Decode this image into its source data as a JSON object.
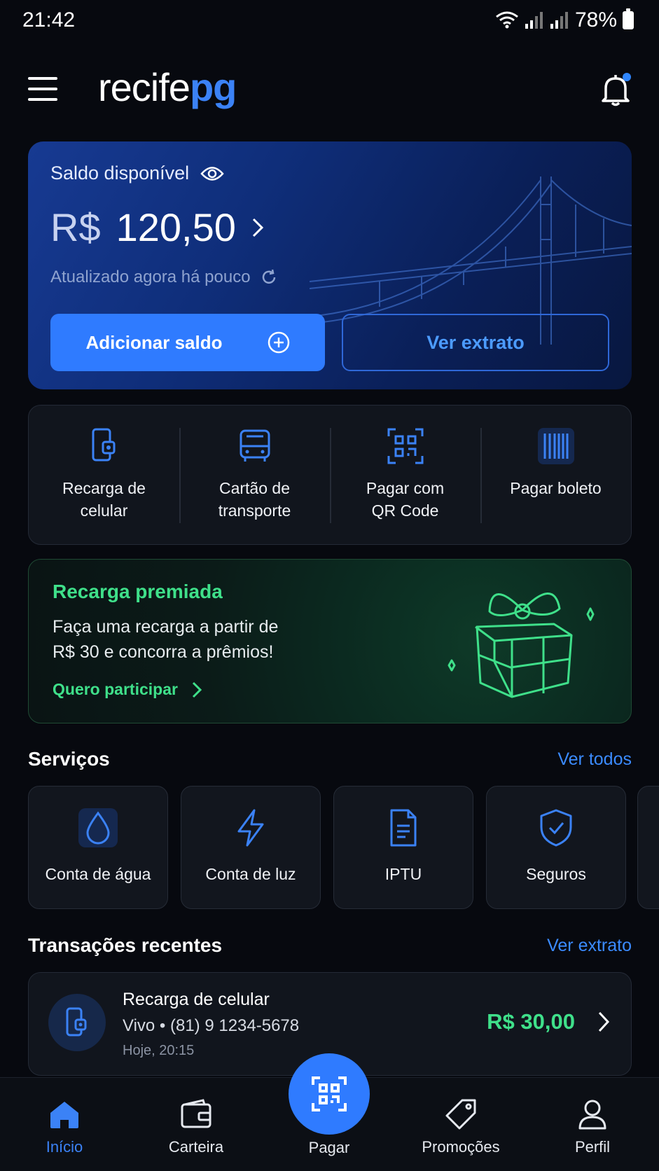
{
  "status_bar": {
    "time": "21:42",
    "battery": "78%"
  },
  "header": {
    "logo_part1": "recife",
    "logo_part2": "pg"
  },
  "balance": {
    "label": "Saldo disponível",
    "currency": "R$",
    "amount": "120,50",
    "updated": "Atualizado agora há pouco",
    "add_button": "Adicionar saldo",
    "extract_button": "Ver extrato"
  },
  "quick_actions": [
    {
      "label": "Recarga de\ncelular",
      "icon": "phone-recharge-icon"
    },
    {
      "label": "Cartão de\ntransporte",
      "icon": "bus-icon"
    },
    {
      "label": "Pagar com\nQR Code",
      "icon": "qr-code-icon"
    },
    {
      "label": "Pagar boleto",
      "icon": "barcode-icon"
    }
  ],
  "promo": {
    "title": "Recarga premiada",
    "text": "Faça uma recarga a partir de\nR$ 30 e concorra a prêmios!",
    "link": "Quero participar"
  },
  "services": {
    "title": "Serviços",
    "link": "Ver todos",
    "items": [
      {
        "label": "Conta de água",
        "icon": "water-drop-icon"
      },
      {
        "label": "Conta de luz",
        "icon": "lightning-icon"
      },
      {
        "label": "IPTU",
        "icon": "document-icon"
      },
      {
        "label": "Seguros",
        "icon": "shield-icon"
      }
    ]
  },
  "transactions": {
    "title": "Transações recentes",
    "link": "Ver extrato",
    "items": [
      {
        "title": "Recarga de celular",
        "subtitle": "Vivo • (81) 9 1234-5678",
        "time": "Hoje, 20:15",
        "amount": "R$ 30,00"
      }
    ]
  },
  "bottom_nav": {
    "items": [
      "Início",
      "Carteira",
      "Pagar",
      "Promoções",
      "Perfil"
    ],
    "active": "Início"
  },
  "colors": {
    "accent": "#2f7bff",
    "success": "#3fe08a",
    "background": "#07090f"
  }
}
